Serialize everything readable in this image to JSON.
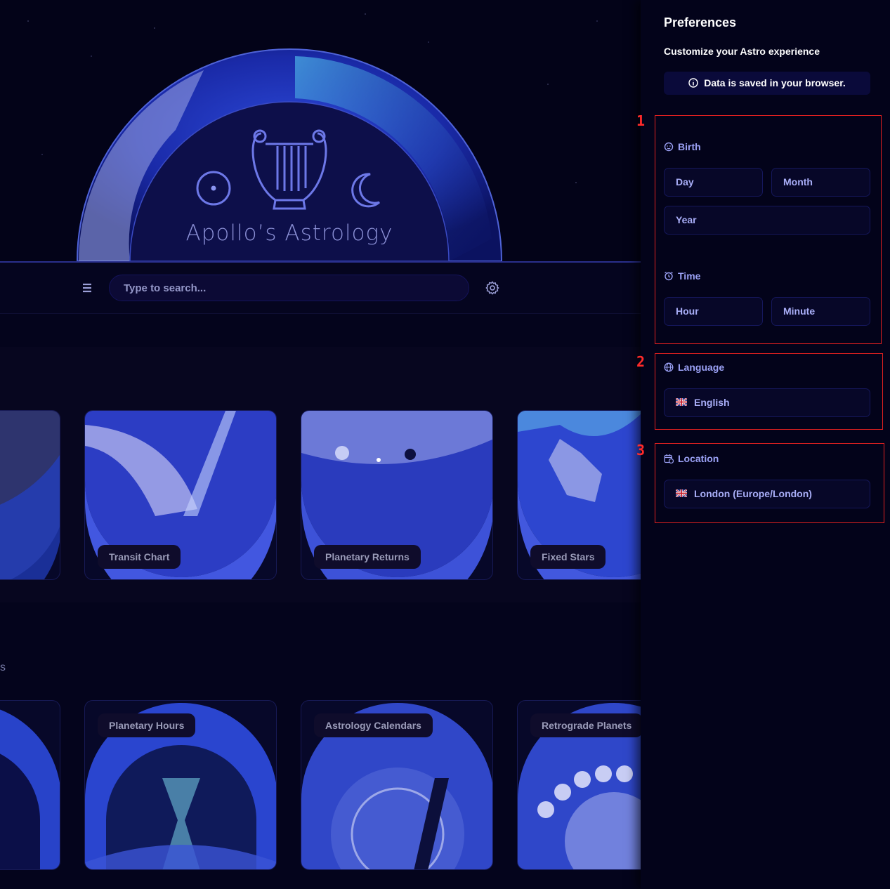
{
  "hero": {
    "title": "Apollo’s Astrology"
  },
  "toolbar": {
    "search_placeholder": "Type to search..."
  },
  "section1": {
    "cards": [
      {
        "label": ""
      },
      {
        "label": "Transit Chart"
      },
      {
        "label": "Planetary Returns"
      },
      {
        "label": "Fixed Stars"
      }
    ]
  },
  "section2": {
    "label_fragment": "s",
    "cards": [
      {
        "label": ""
      },
      {
        "label": "Planetary Hours"
      },
      {
        "label": "Astrology Calendars"
      },
      {
        "label": "Retrograde Planets"
      }
    ]
  },
  "preferences": {
    "title": "Preferences",
    "subtitle": "Customize your Astro experience",
    "notice": "Data is saved in your browser.",
    "birth": {
      "heading": "Birth",
      "day_placeholder": "Day",
      "month_placeholder": "Month",
      "year_placeholder": "Year"
    },
    "time": {
      "heading": "Time",
      "hour_placeholder": "Hour",
      "minute_placeholder": "Minute"
    },
    "language": {
      "heading": "Language",
      "value": "English"
    },
    "location": {
      "heading": "Location",
      "value": "London (Europe/London)"
    }
  },
  "annotations": [
    "1",
    "2",
    "3"
  ],
  "colors": {
    "accent": "#9ba1f5",
    "annotation": "#e02020",
    "panel_bg": "#03031a"
  }
}
